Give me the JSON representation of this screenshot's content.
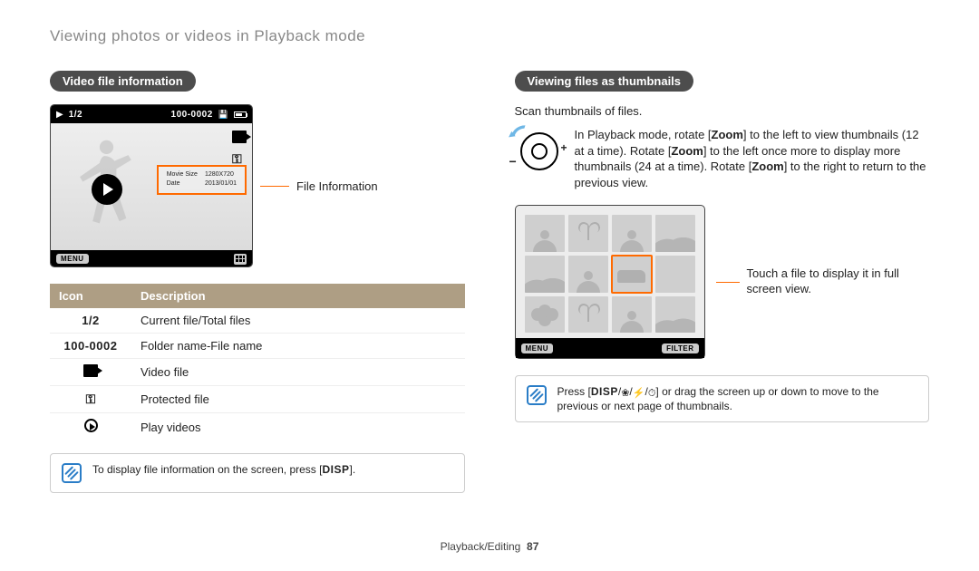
{
  "page_title": "Viewing photos or videos in Playback mode",
  "footer": {
    "section": "Playback/Editing",
    "page": "87"
  },
  "left": {
    "heading": "Video file information",
    "screen": {
      "counter": "1/2",
      "file_id": "100-0002",
      "menu_label": "MENU",
      "info_rows": [
        {
          "k": "Movie Size",
          "v": "1280X720"
        },
        {
          "k": "Date",
          "v": "2013/01/01"
        }
      ]
    },
    "callout": "File Information",
    "table": {
      "headers": [
        "Icon",
        "Description"
      ],
      "rows": [
        {
          "icon_text": "1/2",
          "icon_class": "compact-font",
          "label": "Current file/Total files"
        },
        {
          "icon_text": "100-0002",
          "icon_class": "compact-font",
          "label": "Folder name-File name"
        },
        {
          "icon_text": "",
          "icon_class": "movie-icon",
          "label": "Video file"
        },
        {
          "icon_text": "⚿",
          "icon_class": "key-icon",
          "label": "Protected file"
        },
        {
          "icon_text": "",
          "icon_class": "play-icon",
          "label": "Play videos"
        }
      ]
    },
    "note_pre": "To display file information on the screen, press [",
    "note_disp": "DISP",
    "note_post": "]."
  },
  "right": {
    "heading": "Viewing files as thumbnails",
    "intro": "Scan thumbnails of files.",
    "zoom_desc_parts": [
      "In Playback mode, rotate [",
      "Zoom",
      "] to the left to view thumbnails (12 at a time). Rotate [",
      "Zoom",
      "] to the left once more to display more thumbnails (24 at a time). Rotate [",
      "Zoom",
      "] to the right to return to the previous view."
    ],
    "thumb_screen": {
      "menu_label": "MENU",
      "filter_label": "FILTER"
    },
    "thumb_callout": "Touch a file to display it in full screen view.",
    "note_pre": "Press [",
    "note_disp": "DISP",
    "note_mid": "/",
    "note_post": "] or drag the screen up or down to move to the previous or next page of thumbnails."
  }
}
